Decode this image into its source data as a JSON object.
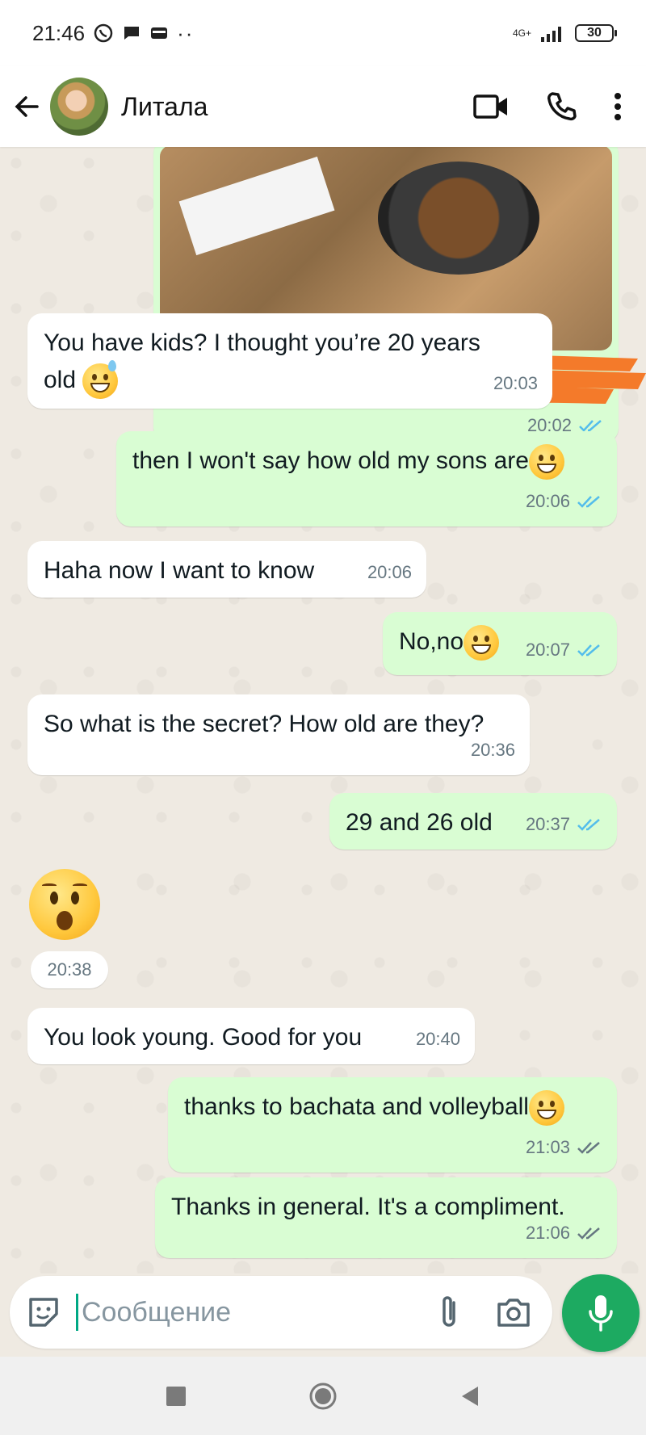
{
  "status_bar": {
    "time": "21:46",
    "network": "4G+",
    "battery": "30",
    "icons": [
      "whatsapp-icon",
      "chat-bubble-icon",
      "wallet-icon",
      "more-dots-icon"
    ]
  },
  "header": {
    "contact_name": "Литала",
    "actions": [
      "video-call-icon",
      "phone-call-icon",
      "more-menu-icon"
    ]
  },
  "messages": [
    {
      "direction": "out",
      "type": "photo",
      "time": "20:02",
      "status": "read"
    },
    {
      "direction": "in",
      "text_line1": "You have kids? I thought you’re 20 years",
      "text_line2": "old",
      "emoji": "grinning-sweat",
      "time": "20:03"
    },
    {
      "direction": "out",
      "text": "then I won't say how old my sons are",
      "emoji": "beaming",
      "time": "20:06",
      "status": "read"
    },
    {
      "direction": "in",
      "text": "Haha now I want to know",
      "time": "20:06"
    },
    {
      "direction": "out",
      "text": "No,no",
      "emoji": "beaming",
      "time": "20:07",
      "status": "read"
    },
    {
      "direction": "in",
      "text": "So what is the secret? How old are they?",
      "time": "20:36"
    },
    {
      "direction": "out",
      "text": "29 and 26 old",
      "time": "20:37",
      "status": "read"
    },
    {
      "direction": "in",
      "type": "big-emoji",
      "emoji": "astonished",
      "time": "20:38"
    },
    {
      "direction": "in",
      "text": "You look young. Good for you",
      "time": "20:40"
    },
    {
      "direction": "out",
      "text": "thanks to bachata and volleyball",
      "emoji": "beaming",
      "time": "21:03",
      "status": "delivered"
    },
    {
      "direction": "out",
      "text": "Thanks in general. It's a compliment.",
      "time": "21:06",
      "status": "delivered"
    }
  ],
  "input": {
    "placeholder": "Сообщение",
    "value": ""
  },
  "colors": {
    "chat_bg": "#efeae2",
    "outgoing": "#d9fdd3",
    "incoming": "#ffffff",
    "read_tick": "#53bdeb",
    "accent": "#1daa61",
    "redaction": "#f47a2a"
  }
}
